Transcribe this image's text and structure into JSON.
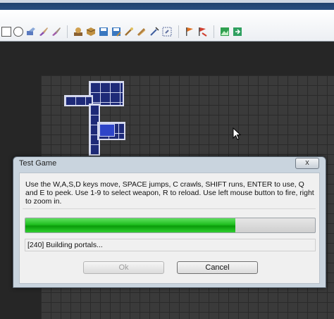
{
  "toolbar": {
    "tools": [
      {
        "icon": "select-square-icon",
        "color": "#555555"
      },
      {
        "icon": "select-circle-icon",
        "color": "#555555"
      },
      {
        "icon": "pencil-icon",
        "color": "#5a7ac0"
      },
      {
        "icon": "brush-icon",
        "color": "#8a4fb0"
      },
      {
        "icon": "paint-icon",
        "color": "#a05aa8"
      },
      {
        "icon": "stamp-icon",
        "color": "#b07a30"
      },
      {
        "icon": "cube-icon",
        "color": "#c09040"
      },
      {
        "icon": "save-icon",
        "color": "#3a78c0"
      },
      {
        "icon": "save-as-icon",
        "color": "#3a78c0"
      },
      {
        "icon": "wand-icon",
        "color": "#c09040"
      },
      {
        "icon": "wand-alt-icon",
        "color": "#c09040"
      },
      {
        "icon": "syringe-icon",
        "color": "#4060a0"
      },
      {
        "icon": "zoom-box-icon",
        "color": "#6070a0"
      },
      {
        "icon": "flag-icon",
        "color": "#e07020"
      },
      {
        "icon": "flag-red-icon",
        "color": "#d04030"
      },
      {
        "icon": "image-icon",
        "color": "#30a050"
      },
      {
        "icon": "export-icon",
        "color": "#30a060"
      }
    ]
  },
  "dialog": {
    "title": "Test Game",
    "close_label": "x",
    "message": "Use the W,A,S,D keys move, SPACE jumps, C crawls, SHIFT runs, ENTER to use, Q and E to peek. Use 1-9 to select weapon, R to reload. Use left mouse button to fire, right to zoom in.",
    "progress_fraction": 0.725,
    "progress_color": "#1fbf1f",
    "status": "[240] Building portals...",
    "ok_label": "Ok",
    "ok_enabled": false,
    "cancel_label": "Cancel"
  }
}
